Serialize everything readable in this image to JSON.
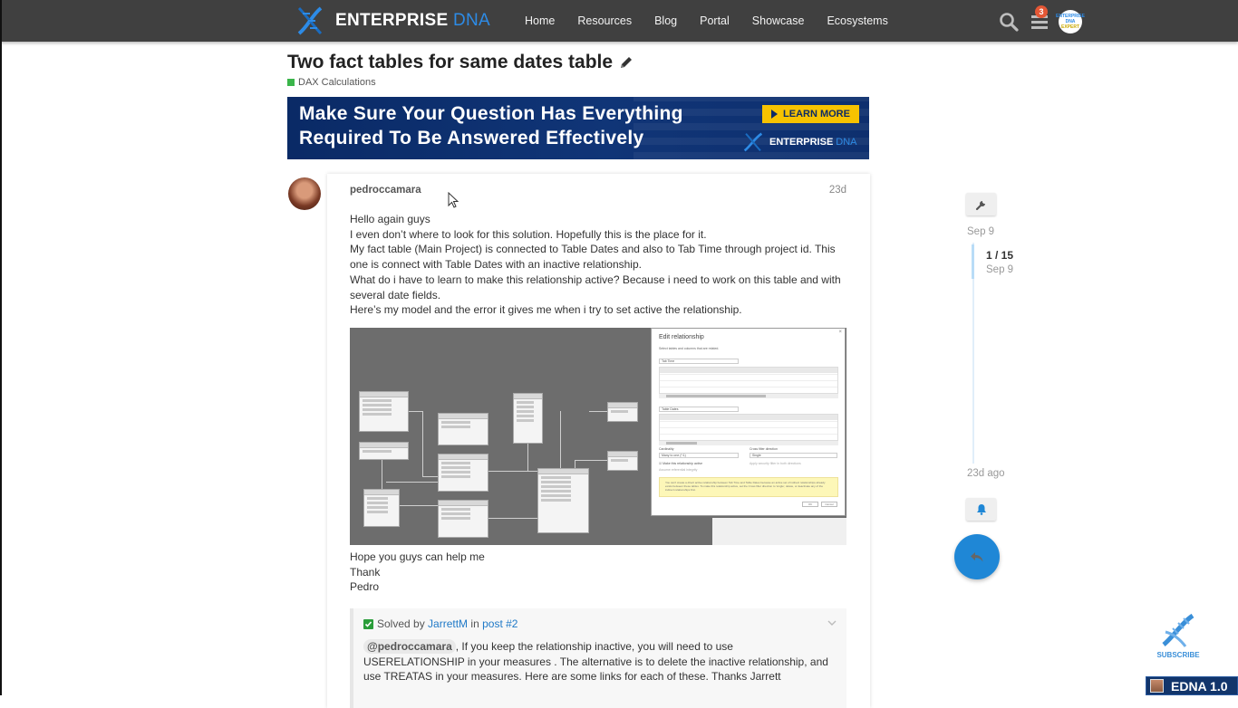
{
  "header": {
    "brand_main": "ENTERPRISE",
    "brand_accent": "DNA",
    "nav": [
      "Home",
      "Resources",
      "Blog",
      "Portal",
      "Showcase",
      "Ecosystems"
    ],
    "notification_count": "3",
    "avatar_line1": "ENTERPRISE DNA",
    "avatar_line2": "EXPERT"
  },
  "topic": {
    "title": "Two fact tables for same dates table",
    "category": "DAX Calculations",
    "category_color": "#3ab54a"
  },
  "banner": {
    "line1": "Make Sure Your Question Has Everything",
    "line2": "Required To Be Answered Effectively",
    "cta": "LEARN MORE",
    "logo_main": "ENTERPRISE",
    "logo_accent": "DNA"
  },
  "post": {
    "username": "pedroccamara",
    "age": "23d",
    "body": [
      "Hello again guys",
      "I even don’t where to look for this solution. Hopefully this is the place for it.",
      "My fact table (Main Project) is connected to Table Dates and also to Tab Time through project id. This one is connect with Table Dates with an inactive relationship.",
      "What do i have to learn to make this relationship active? Because i need to work on this table and with several date fields.",
      "Here’s my model and the error it gives me when i try to set active the relationship."
    ],
    "image": {
      "dialog_title": "Edit relationship",
      "dialog_subtitle": "Select tables and columns that are related.",
      "table1": "Tab Time",
      "table2": "Table Dates",
      "cardinality_label": "Cardinality",
      "cardinality_value": "Many to one (*:1)",
      "crossfilter_label": "Cross filter direction",
      "crossfilter_value": "Single",
      "active_checkbox": "Make this relationship active",
      "referential": "Assume referential integrity",
      "security": "Apply security filter in both directions",
      "warning": "You can't create a direct active relationship between Tab Time and Table Dates because an active set of indirect relationships already exists between these tables. To make this relationship active, set the Cross filter direction to 'single', delete, or deactivate any of the indirect relationships first.",
      "ok": "OK",
      "cancel": "Cancel"
    },
    "closing": [
      "Hope you guys can help me",
      "Thank",
      "Pedro"
    ]
  },
  "solution": {
    "prefix": "Solved by",
    "solver": "JarrettM",
    "in": "in",
    "post_link": "post #2",
    "mention": "@pedroccamara",
    "text": ", If you keep the relationship inactive, you will need to use USERELATIONSHIP in your measures . The alternative is to delete the inactive relationship, and use TREATAS in your measures. Here are some links for each of these. Thanks Jarrett"
  },
  "timeline": {
    "start_date": "Sep 9",
    "position": "1 / 15",
    "position_date": "Sep 9",
    "end_label": "23d ago"
  },
  "overlay": {
    "subscribe": "SUBSCRIBE",
    "edna": "EDNA 1.0"
  }
}
